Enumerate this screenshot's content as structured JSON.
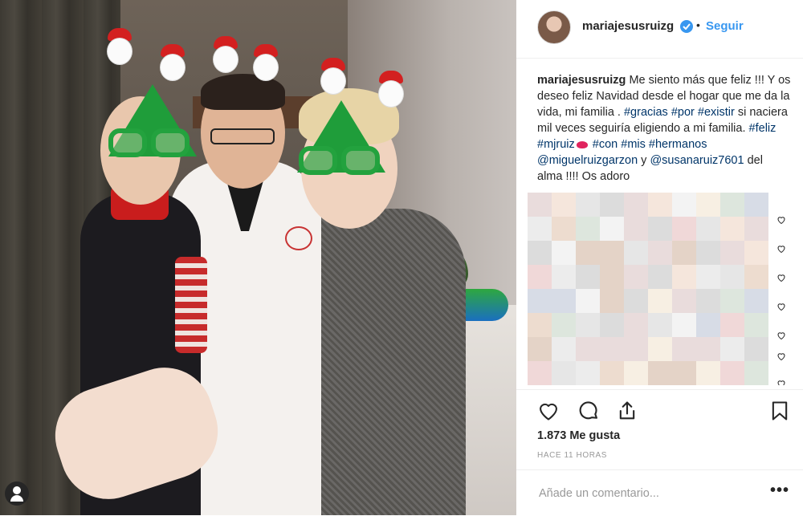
{
  "post": {
    "username": "mariajesusruizg",
    "separator": "•",
    "follow_label": "Seguir",
    "caption": {
      "user": "mariajesusruizg",
      "text_1": " Me siento más que feliz !!! Y os deseo feliz Navidad desde el hogar que me da la vida, mi familia . ",
      "tag_gracias": "#gracias",
      "tag_por": "#por",
      "tag_existir": "#existir",
      "text_2": " si naciera mil veces seguiría eligiendo a mi familia. ",
      "tag_feliz": "#feliz",
      "tag_mjruiz": "#mjruiz",
      "tag_con": "#con",
      "tag_mis": "#mis",
      "tag_hermanos": "#hermanos",
      "mention_1": "@miguelruizgarzon",
      "text_3": " y ",
      "mention_2": "@susanaruiz7601",
      "text_4": " del alma !!!! Os adoro"
    },
    "likes_text": "1.873 Me gusta",
    "time_text": "HACE 11 HORAS",
    "comment_placeholder": "Añade un comentario...",
    "more_label": "•••"
  },
  "icons": {
    "verified": "verified-badge-icon",
    "like": "heart-icon",
    "comment": "comment-bubble-icon",
    "share": "share-icon",
    "save": "bookmark-icon",
    "user_tag": "user-tag-icon"
  },
  "colors": {
    "accent_blue": "#3897f0",
    "hashtag": "#003569",
    "text": "#262626",
    "muted": "#999999",
    "border": "#efefef"
  }
}
